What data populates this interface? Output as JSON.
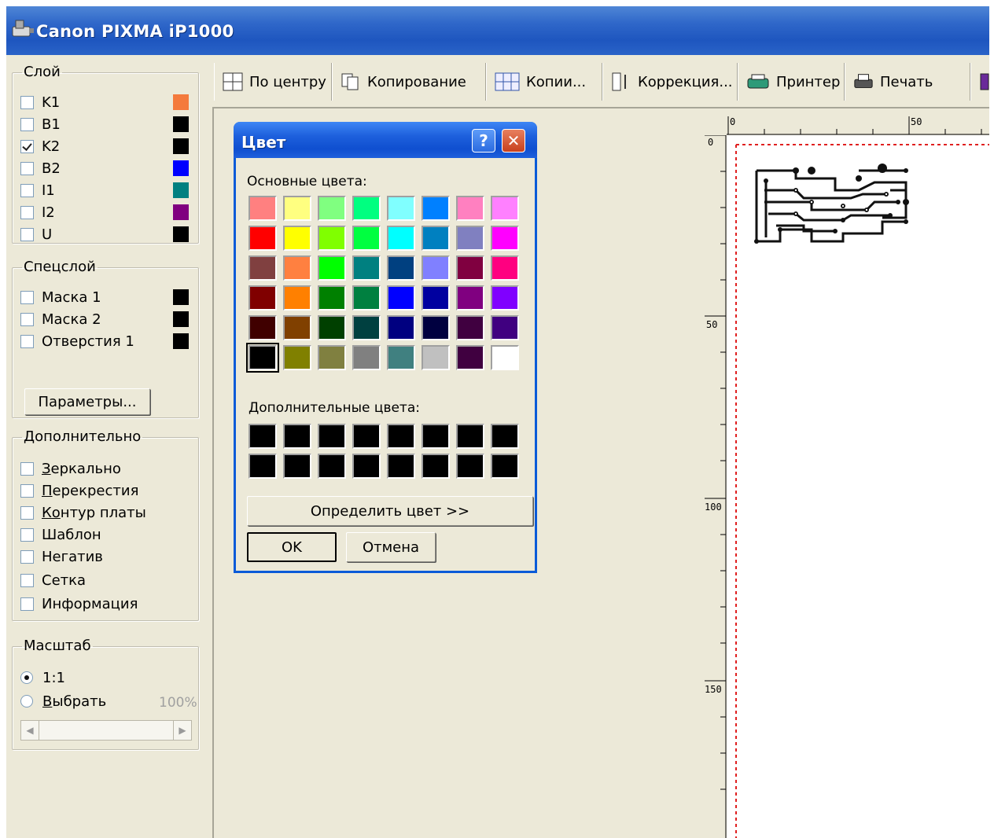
{
  "window": {
    "title": "Canon PIXMA iP1000"
  },
  "layers": {
    "title": "Слой",
    "items": [
      {
        "label": "K1",
        "checked": false,
        "color": "#f47a3c"
      },
      {
        "label": "B1",
        "checked": false,
        "color": "#000000"
      },
      {
        "label": "K2",
        "checked": true,
        "color": "#000000"
      },
      {
        "label": "B2",
        "checked": false,
        "color": "#0000ff"
      },
      {
        "label": "I1",
        "checked": false,
        "color": "#008080"
      },
      {
        "label": "I2",
        "checked": false,
        "color": "#800080"
      },
      {
        "label": "U",
        "checked": false,
        "color": "#000000"
      }
    ]
  },
  "special": {
    "title": "Спецслой",
    "items": [
      {
        "label": "Маска 1",
        "checked": false,
        "color": "#000000"
      },
      {
        "label": "Маска 2",
        "checked": false,
        "color": "#000000"
      },
      {
        "label": "Отверстия 1",
        "checked": false,
        "color": "#000000"
      }
    ],
    "params_button": "Параметры..."
  },
  "extra": {
    "title": "Дополнительно",
    "items": [
      {
        "label": "Зеркально",
        "accel": "З",
        "rest": "еркально"
      },
      {
        "label": "Перекрестия",
        "accel": "П",
        "rest": "ерекрестия"
      },
      {
        "label": "Контур платы",
        "accel": "Ко",
        "rest": "нтур платы"
      },
      {
        "label": "Шаблон",
        "accel": "",
        "rest": "Шаблон"
      },
      {
        "label": "Негатив",
        "accel": "",
        "rest": "Негатив"
      },
      {
        "label": "Сетка",
        "accel": "",
        "rest": "Сетка"
      },
      {
        "label": "Информация",
        "accel": "",
        "rest": "Информация"
      }
    ]
  },
  "scale": {
    "title": "Масштаб",
    "opt1": "1:1",
    "opt2_accel": "В",
    "opt2_rest": "ыбрать",
    "selected": "1:1",
    "percent": "100%"
  },
  "toolbar": [
    {
      "label": "По центру",
      "icon": "center-icon"
    },
    {
      "label": "Копирование",
      "icon": "copy-icon"
    },
    {
      "label": "Копии...",
      "icon": "copies-grid-icon"
    },
    {
      "label": "Коррекция...",
      "icon": "correction-icon"
    },
    {
      "label": "Принтер",
      "icon": "printer-setup-icon"
    },
    {
      "label": "Печать",
      "icon": "print-icon"
    }
  ],
  "rulers": {
    "h": [
      "0",
      "50"
    ],
    "v": [
      "0",
      "50",
      "100",
      "150"
    ]
  },
  "color_dialog": {
    "title": "Цвет",
    "help": "?",
    "basic_label": "Основные цвета:",
    "custom_label": "Дополнительные цвета:",
    "define_button": "Определить цвет >>",
    "ok": "OK",
    "cancel": "Отмена",
    "basic_colors": [
      "#ff8080",
      "#ffff80",
      "#80ff80",
      "#00ff80",
      "#80ffff",
      "#0080ff",
      "#ff80c0",
      "#ff80ff",
      "#ff0000",
      "#ffff00",
      "#80ff00",
      "#00ff40",
      "#00ffff",
      "#0080c0",
      "#8080c0",
      "#ff00ff",
      "#804040",
      "#ff8040",
      "#00ff00",
      "#008080",
      "#004080",
      "#8080ff",
      "#800040",
      "#ff0080",
      "#800000",
      "#ff8000",
      "#008000",
      "#008040",
      "#0000ff",
      "#0000a0",
      "#800080",
      "#8000ff",
      "#400000",
      "#804000",
      "#004000",
      "#004040",
      "#000080",
      "#000040",
      "#400040",
      "#400080",
      "#000000",
      "#808000",
      "#808040",
      "#808080",
      "#408080",
      "#c0c0c0",
      "#400040",
      "#ffffff"
    ],
    "selected_index": 40,
    "custom_colors": [
      "#000000",
      "#000000",
      "#000000",
      "#000000",
      "#000000",
      "#000000",
      "#000000",
      "#000000",
      "#000000",
      "#000000",
      "#000000",
      "#000000",
      "#000000",
      "#000000",
      "#000000",
      "#000000"
    ]
  }
}
